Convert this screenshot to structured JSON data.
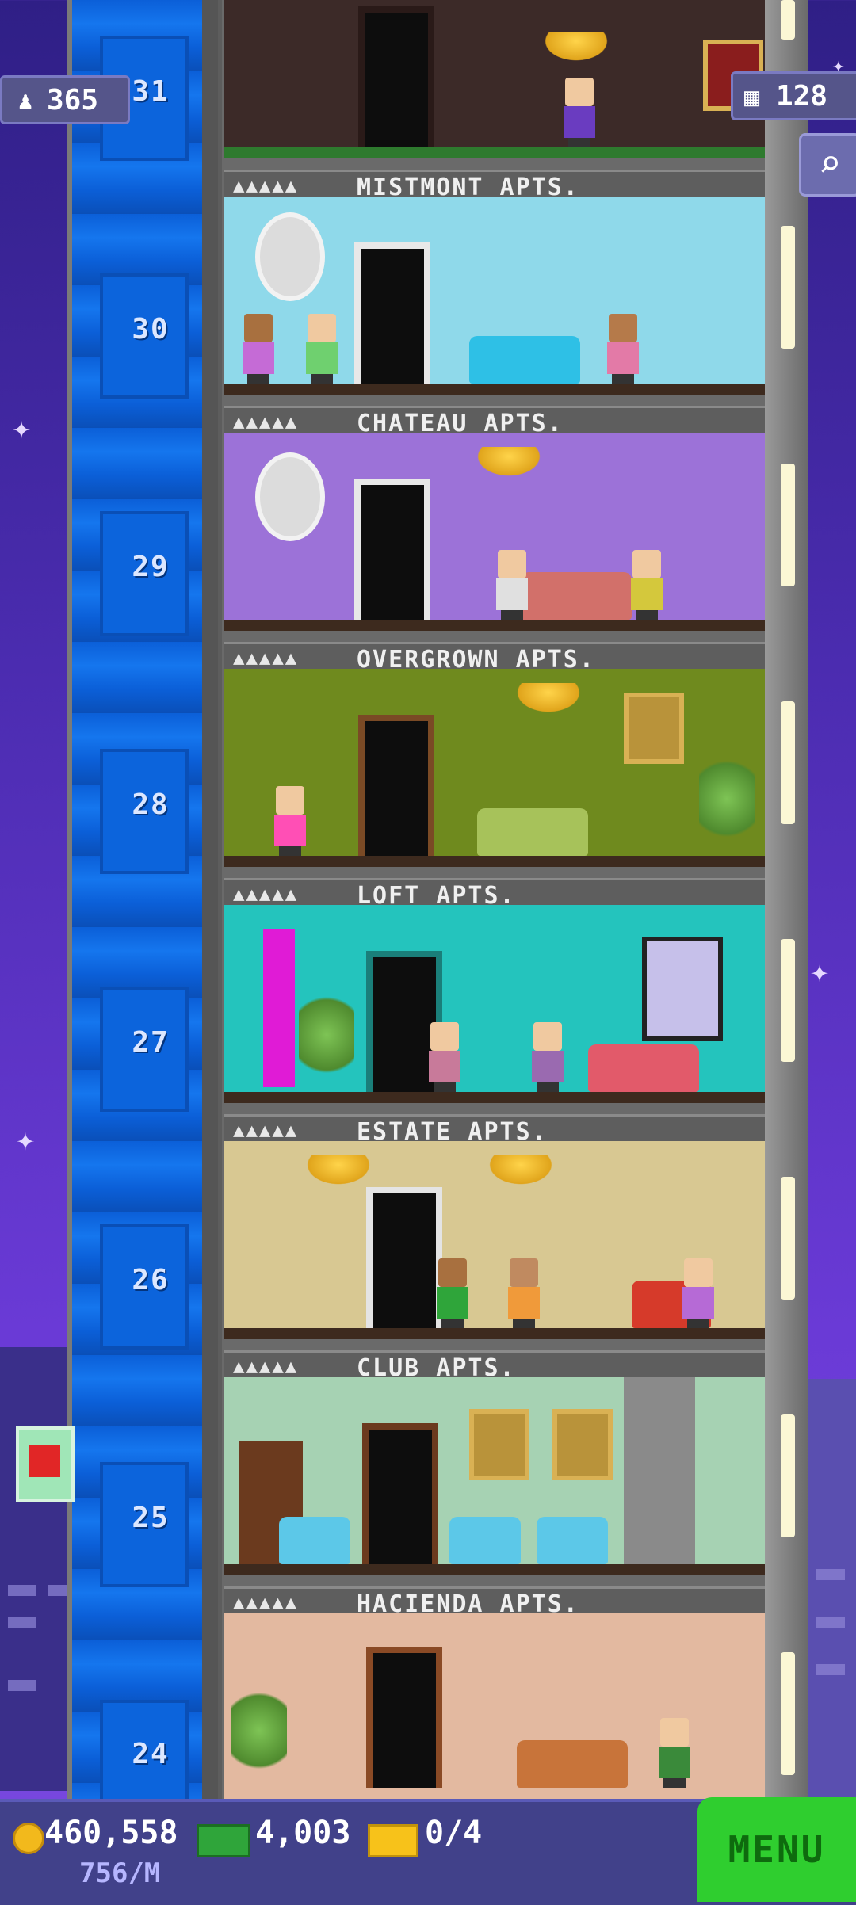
{
  "stats": {
    "population": "365",
    "floors": "128"
  },
  "icons": {
    "population": "person-icon",
    "floors": "building-icon",
    "search": "magnifier-icon"
  },
  "elevator_floors": [
    "31",
    "30",
    "29",
    "28",
    "27",
    "26",
    "25",
    "24"
  ],
  "floors": [
    {
      "number": "31",
      "name": "MISTMONT APTS.",
      "people": "▲▲▲▲▲",
      "wall": "#3c2a28"
    },
    {
      "number": "30",
      "name": "CHATEAU APTS.",
      "people": "▲▲▲▲▲",
      "wall": "#8fd9ea"
    },
    {
      "number": "29",
      "name": "OVERGROWN APTS.",
      "people": "▲▲▲▲▲",
      "wall": "#9c72d8"
    },
    {
      "number": "28",
      "name": "LOFT APTS.",
      "people": "▲▲▲▲▲",
      "wall": "#6f8a1e"
    },
    {
      "number": "27",
      "name": "ESTATE APTS.",
      "people": "▲▲▲▲▲",
      "wall": "#24c4bd"
    },
    {
      "number": "26",
      "name": "CLUB APTS.",
      "people": "▲▲▲▲▲",
      "wall": "#d8c892"
    },
    {
      "number": "25",
      "name": "HACIENDA APTS.",
      "people": "▲▲▲▲▲",
      "wall": "#a6d2b3"
    },
    {
      "number": "24",
      "name": "",
      "people": "",
      "wall": "#e3b9a0"
    }
  ],
  "bottom": {
    "coins": "460,558",
    "rate": "756/M",
    "bux": "4,003",
    "tickets": "0/4",
    "menu": "MENU"
  },
  "colors": {
    "elevator": "#0b5fd8",
    "menu_button": "#2fce2f",
    "sky": "#4b2cb0"
  }
}
